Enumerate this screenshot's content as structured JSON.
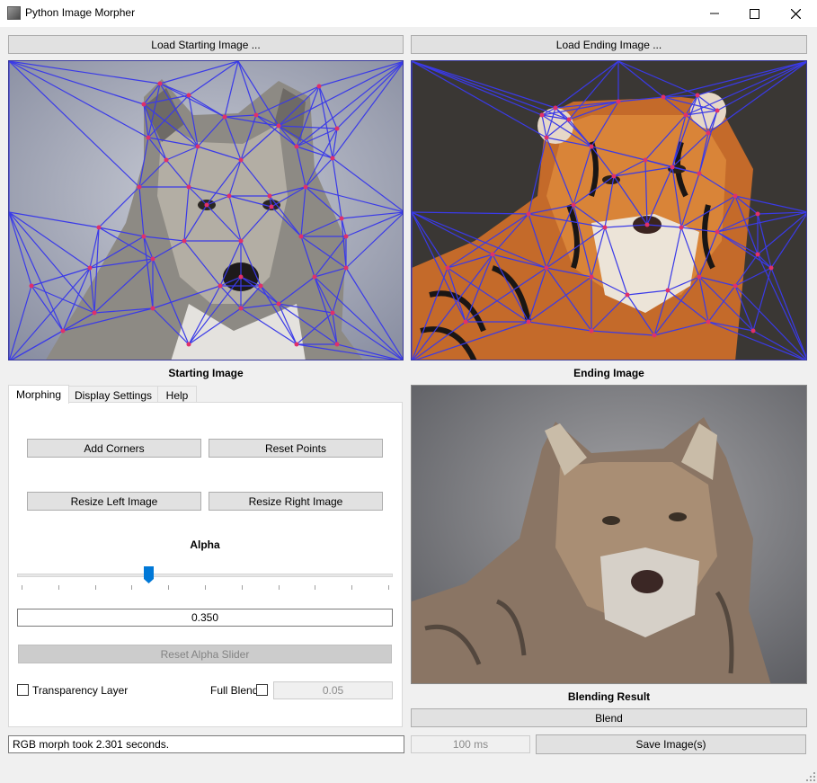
{
  "window": {
    "title": "Python Image Morpher",
    "icons": [
      "app-icon",
      "minimize-icon",
      "maximize-icon",
      "close-icon"
    ]
  },
  "toolbar": {
    "load_start_label": "Load Starting Image ...",
    "load_end_label": "Load Ending Image ..."
  },
  "images": {
    "start_caption": "Starting Image",
    "end_caption": "Ending Image",
    "result_caption": "Blending Result",
    "triangulation_color": "#3a3ae8",
    "point_color": "#e0306a"
  },
  "tabs": [
    {
      "label": "Morphing",
      "active": true
    },
    {
      "label": "Display Settings",
      "active": false
    },
    {
      "label": "Help",
      "active": false
    }
  ],
  "morphing": {
    "add_corners_label": "Add Corners",
    "reset_points_label": "Reset Points",
    "resize_left_label": "Resize Left Image",
    "resize_right_label": "Resize Right Image",
    "alpha_label": "Alpha",
    "alpha_value": "0.350",
    "alpha_fraction": 0.35,
    "reset_alpha_label": "Reset Alpha Slider",
    "transparency_label": "Transparency Layer",
    "transparency_checked": false,
    "full_blend_label": "Full Blend",
    "full_blend_checked": false,
    "blend_step_value": "0.05"
  },
  "bottom": {
    "blend_label": "Blend",
    "interval_value": "100 ms",
    "save_label": "Save Image(s)",
    "status_text": "RGB morph took 2.301 seconds."
  },
  "colors": {
    "accent": "#0078d7",
    "button_bg": "#e1e1e1",
    "window_bg": "#f0f0f0"
  }
}
